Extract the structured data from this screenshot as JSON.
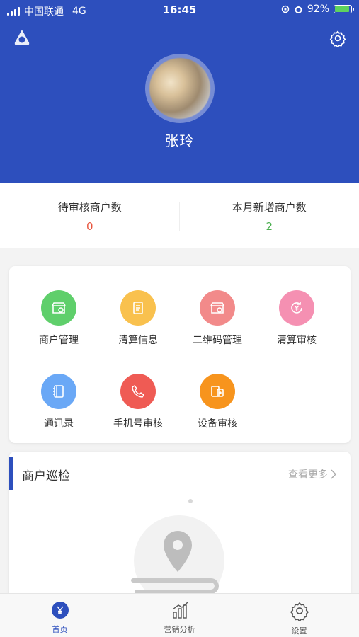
{
  "status_bar": {
    "carrier": "中国联通",
    "network": "4G",
    "time": "16:45",
    "battery": "92%",
    "battery_level": 0.92
  },
  "profile": {
    "name": "张玲"
  },
  "stats": [
    {
      "label": "待审核商户数",
      "value": "0",
      "color": "#e8553e"
    },
    {
      "label": "本月新增商户数",
      "value": "2",
      "color": "#4caf50"
    }
  ],
  "menu": [
    {
      "label": "商户管理",
      "color": "#5fcf6b",
      "icon": "store-icon"
    },
    {
      "label": "清算信息",
      "color": "#f9c14e",
      "icon": "document-icon"
    },
    {
      "label": "二维码管理",
      "color": "#f28a8a",
      "icon": "store-qr-icon"
    },
    {
      "label": "清算审核",
      "color": "#f590b2",
      "icon": "yen-refresh-icon"
    },
    {
      "label": "通讯录",
      "color": "#6aa8f6",
      "icon": "contacts-icon"
    },
    {
      "label": "手机号审核",
      "color": "#ef5b54",
      "icon": "phone-icon"
    },
    {
      "label": "设备审核",
      "color": "#f7941d",
      "icon": "device-icon"
    }
  ],
  "patrol": {
    "title": "商户巡检",
    "more": "查看更多"
  },
  "tabs": [
    {
      "label": "首页",
      "active": true,
      "icon": "home-yen-icon"
    },
    {
      "label": "营销分析",
      "active": false,
      "icon": "bar-chart-icon"
    },
    {
      "label": "设置",
      "active": false,
      "icon": "settings-icon"
    }
  ]
}
